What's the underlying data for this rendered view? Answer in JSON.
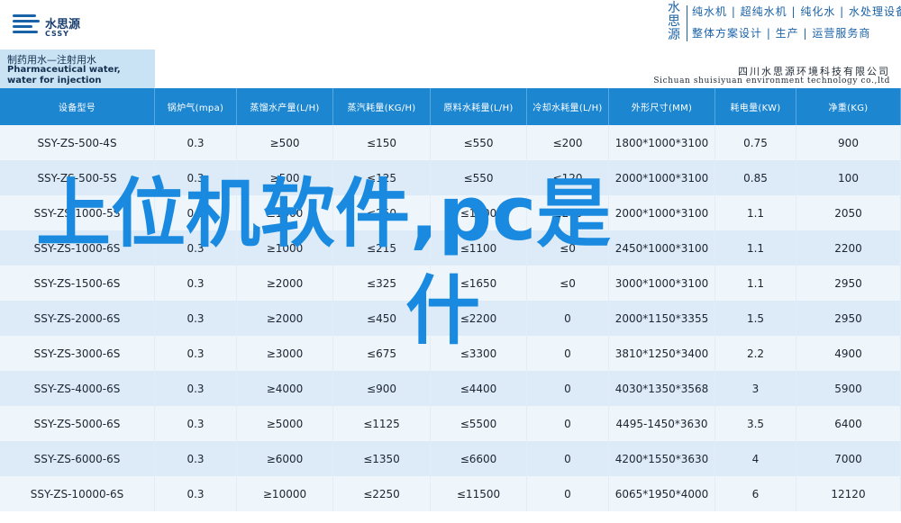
{
  "header": {
    "logo_cn": "水思源",
    "logo_en": "CSSY",
    "slogan_brand": "水思源",
    "slogan_line1": "纯水机 | 超纯水机 | 纯化水 | 水处理设备",
    "slogan_line2": "整体方案设计 | 生产 | 运营服务商"
  },
  "title_strip": {
    "title_cn": "制药用水—注射用水",
    "title_en": "Pharmaceutical water, water for injection",
    "company_cn": "四川水思源环境科技有限公司",
    "company_en": "Sichuan shuisiyuan environment technology co.,ltd"
  },
  "table": {
    "columns": [
      "设备型号",
      "锅炉气(mpa)",
      "蒸馏水产量(L/H)",
      "蒸汽耗量(KG/H)",
      "原料水耗量(L/H)",
      "冷却水耗量(L/H)",
      "外形尺寸(MM)",
      "耗电量(KW)",
      "净重(KG)"
    ],
    "rows": [
      [
        "SSY-ZS-500-4S",
        "0.3",
        "≥500",
        "≤150",
        "≤550",
        "≤200",
        "1800*1000*3100",
        "0.75",
        "900"
      ],
      [
        "SSY-ZS-500-5S",
        "0.3",
        "≥500",
        "≤125",
        "≤550",
        "≤120",
        "2000*1000*3100",
        "0.85",
        "100"
      ],
      [
        "SSY-ZS-1000-5S",
        "0.3",
        "≥1000",
        "≤250",
        "≤1100",
        "≤240",
        "2000*1000*3100",
        "1.1",
        "2050"
      ],
      [
        "SSY-ZS-1000-6S",
        "0.3",
        "≥1000",
        "≤215",
        "≤1100",
        "≤0",
        "2450*1000*3100",
        "1.1",
        "2200"
      ],
      [
        "SSY-ZS-1500-6S",
        "0.3",
        "≥2000",
        "≤325",
        "≤1650",
        "≤0",
        "3000*1000*3100",
        "1.1",
        "2950"
      ],
      [
        "SSY-ZS-2000-6S",
        "0.3",
        "≥2000",
        "≤450",
        "≤2200",
        "0",
        "2000*1150*3355",
        "1.5",
        "2950"
      ],
      [
        "SSY-ZS-3000-6S",
        "0.3",
        "≥3000",
        "≤675",
        "≤3300",
        "0",
        "3810*1250*3400",
        "2.2",
        "4900"
      ],
      [
        "SSY-ZS-4000-6S",
        "0.3",
        "≥4000",
        "≤900",
        "≤4400",
        "0",
        "4030*1350*3568",
        "3",
        "5900"
      ],
      [
        "SSY-ZS-5000-6S",
        "0.3",
        "≥5000",
        "≤1125",
        "≤5500",
        "0",
        "4495-1450*3630",
        "3.5",
        "6400"
      ],
      [
        "SSY-ZS-6000-6S",
        "0.3",
        "≥6000",
        "≤1350",
        "≤6600",
        "0",
        "4200*1550*3630",
        "4",
        "7000"
      ],
      [
        "SSY-ZS-10000-6S",
        "0.3",
        "≥10000",
        "≤2250",
        "≤11500",
        "0",
        "6065*1950*4000",
        "6",
        "12120"
      ]
    ]
  },
  "overlay": {
    "line1": "上位机软件,pc是",
    "line2": "什"
  },
  "colors": {
    "header_blue": "#1c86d1",
    "overlay_blue": "#198ae0",
    "row_light": "#eef5fb",
    "row_dark": "#dcebf7"
  }
}
